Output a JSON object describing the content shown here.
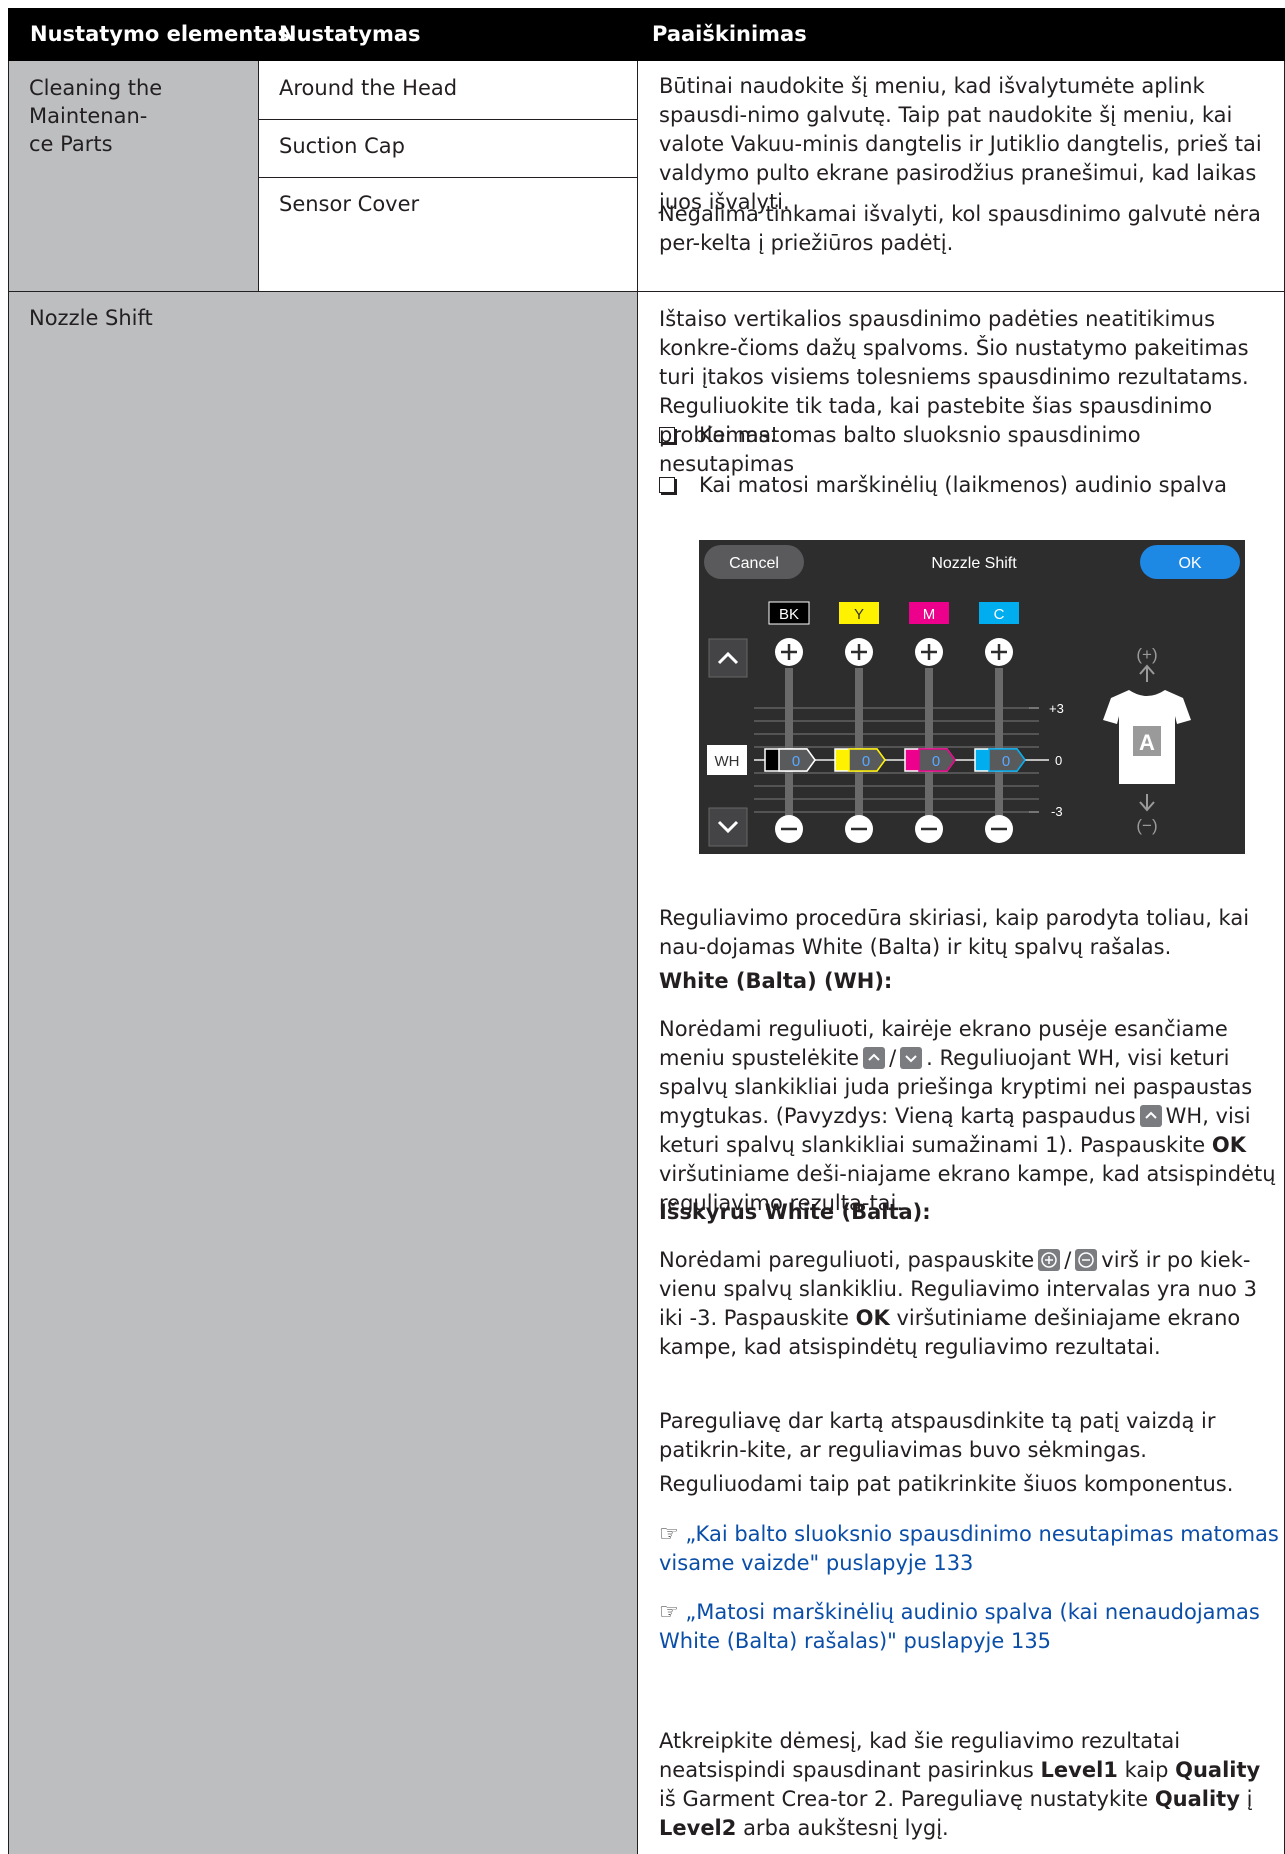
{
  "header": {
    "col1": "Nustatymo elementas",
    "col2": "Nustatymas",
    "col3": "Paaiškinimas"
  },
  "row1": {
    "item": "Cleaning the Maintenan-\nce Parts",
    "settings": [
      "Around the Head",
      "Suction Cap",
      "Sensor Cover"
    ],
    "p1": "Būtinai naudokite šį meniu, kad išvalytumėte aplink spausdi-nimo galvutę. Taip pat naudokite šį meniu, kai valote Vakuu-minis dangtelis ir Jutiklio dangtelis, prieš tai valdymo pulto ekrane pasirodžius pranešimui, kad laikas juos išvalyti.",
    "p2": "Negalima tinkamai išvalyti, kol spausdinimo galvutė nėra per-kelta į priežiūros padėtį."
  },
  "row2": {
    "item": "Nozzle Shift",
    "intro": "Ištaiso vertikalios spausdinimo padėties neatitikimus konkre-čioms dažų spalvoms. Šio nustatymo pakeitimas turi įtakos visiems tolesniems spausdinimo rezultatams. Reguliuokite tik tada, kai pastebite šias spausdinimo problemas.",
    "bullet1": "Kai matomas balto sluoksnio spausdinimo nesutapimas",
    "bullet2": "Kai matosi marškinėlių (laikmenos) audinio spalva",
    "screen": {
      "cancel": "Cancel",
      "title": "Nozzle Shift",
      "ok": "OK",
      "colors": [
        "BK",
        "Y",
        "M",
        "C"
      ],
      "wh": "WH",
      "values": [
        "0",
        "0",
        "0",
        "0"
      ],
      "scale_top": "+3",
      "scale_mid": "0",
      "scale_bottom": "-3",
      "plus_label": "(+)",
      "minus_label": "(−)",
      "shirt_letter": "A"
    },
    "procedure": "Reguliavimo procedūra skiriasi, kaip parodyta toliau, kai nau-dojamas White (Balta) ir kitų spalvų rašalas.",
    "white_heading": "White (Balta) (WH):",
    "white_p_a": "Norėdami reguliuoti, kairėje ekrano pusėje esančiame meniu spustelėkite",
    "white_p_slash": "/",
    "white_p_b": ". Reguliuojant WH, visi keturi spalvų slankikliai juda priešinga kryptimi nei paspaustas mygtukas. (Pavyzdys: Vieną kartą paspaudus",
    "white_p_c": "WH, visi keturi spalvų slankikliai sumažinami 1). Paspauskite",
    "white_p_ok": "OK",
    "white_p_d": "viršutiniame deši-niajame ekrano kampe, kad atsispindėtų reguliavimo rezulta-tai.",
    "other_heading": "Išskyrus White (Balta):",
    "other_p_a": "Norėdami pareguliuoti, paspauskite",
    "other_p_slash": "/",
    "other_p_b": "virš ir po kiek-vienu spalvų slankikliu. Reguliavimo intervalas yra nuo 3 iki -3. Paspauskite",
    "other_p_ok": "OK",
    "other_p_c": "viršutiniame dešiniajame ekrano kampe, kad atsispindėtų reguliavimo rezultatai.",
    "after1": "Pareguliavę dar kartą atspausdinkite tą patį vaizdą ir patikrin-kite, ar reguliavimas buvo sėkmingas.",
    "after2": "Reguliuodami taip pat patikrinkite šiuos komponentus.",
    "link_icon": "☞",
    "link1": "„Kai balto sluoksnio spausdinimo nesutapimas matomas visame vaizde\" puslapyje 133",
    "link2": "„Matosi marškinėlių audinio spalva (kai nenaudojamas White (Balta) rašalas)\" puslapyje 135",
    "note_a": "Atkreipkite dėmesį, kad šie reguliavimo rezultatai neatsispindi spausdinant pasirinkus",
    "note_level1": "Level1",
    "note_b": "kaip",
    "note_quality": "Quality",
    "note_c": "iš Garment Crea-tor 2. Pareguliavę nustatykite",
    "note_quality2": "Quality",
    "note_d": "į",
    "note_level2": "Level2",
    "note_e": "arba aukštesnį lygį."
  }
}
